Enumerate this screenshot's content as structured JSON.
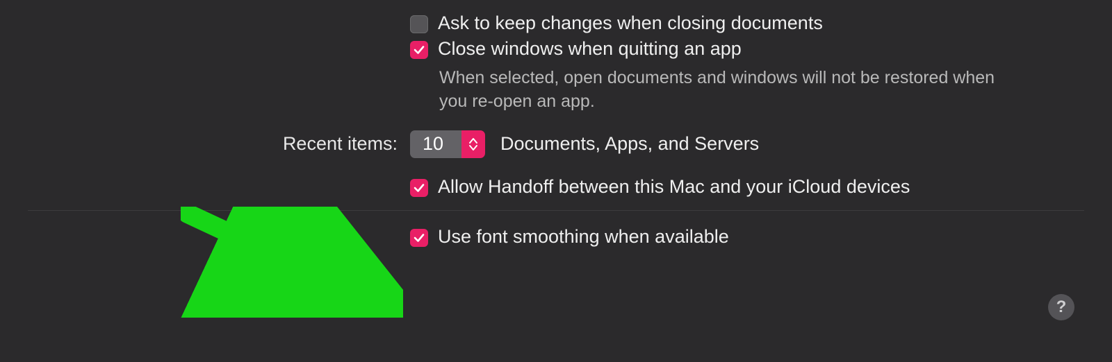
{
  "options": {
    "askKeepChanges": {
      "label": "Ask to keep changes when closing documents",
      "checked": false
    },
    "closeWindows": {
      "label": "Close windows when quitting an app",
      "checked": true,
      "explain": "When selected, open documents and windows will not be restored when you re-open an app."
    },
    "recentItems": {
      "fieldLabel": "Recent items:",
      "value": "10",
      "suffix": "Documents, Apps, and Servers"
    },
    "handoff": {
      "label": "Allow Handoff between this Mac and your iCloud devices",
      "checked": true
    },
    "fontSmoothing": {
      "label": "Use font smoothing when available",
      "checked": true
    }
  },
  "helpButton": "?",
  "colors": {
    "accent": "#e91f66",
    "arrow": "#17d617",
    "bg": "#2b2a2c"
  }
}
